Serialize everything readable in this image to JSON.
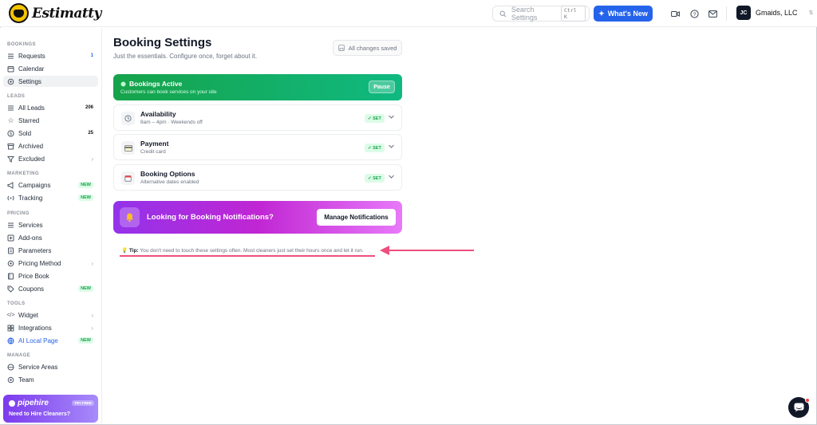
{
  "app": {
    "brand": "Estimatty"
  },
  "topbar": {
    "search_placeholder": "Search Settings",
    "search_shortcut": "Ctrl K",
    "whats_new": "What's New",
    "account": {
      "initials": "JC",
      "name": "Gmaids, LLC"
    }
  },
  "sidebar": {
    "sections": {
      "bookings": "BOOKINGS",
      "leads": "LEADS",
      "marketing": "MARKETING",
      "pricing": "PRICING",
      "tools": "TOOLS",
      "manage": "MANAGE"
    },
    "items": {
      "requests": {
        "label": "Requests",
        "badge": "1"
      },
      "calendar": {
        "label": "Calendar"
      },
      "settings": {
        "label": "Settings"
      },
      "all_leads": {
        "label": "All Leads",
        "badge": "206"
      },
      "starred": {
        "label": "Starred"
      },
      "sold": {
        "label": "Sold",
        "badge": "25"
      },
      "archived": {
        "label": "Archived"
      },
      "excluded": {
        "label": "Excluded"
      },
      "campaigns": {
        "label": "Campaigns",
        "tag": "NEW"
      },
      "tracking": {
        "label": "Tracking",
        "tag": "NEW"
      },
      "services": {
        "label": "Services"
      },
      "add_ons": {
        "label": "Add-ons"
      },
      "parameters": {
        "label": "Parameters"
      },
      "pricing_method": {
        "label": "Pricing Method"
      },
      "price_book": {
        "label": "Price Book"
      },
      "coupons": {
        "label": "Coupons",
        "tag": "NEW"
      },
      "widget": {
        "label": "Widget"
      },
      "integrations": {
        "label": "Integrations"
      },
      "ai_local_page": {
        "label": "AI Local Page",
        "tag": "NEW"
      },
      "service_areas": {
        "label": "Service Areas"
      },
      "team": {
        "label": "Team"
      }
    },
    "promo": {
      "brand": "pipehire",
      "tag": "TRY FREE",
      "text": "Need to Hire Cleaners?"
    }
  },
  "main": {
    "title": "Booking Settings",
    "subtitle": "Just the essentials. Configure once, forget about it.",
    "saved_status": "All changes saved",
    "active_card": {
      "title": "Bookings Active",
      "subtitle": "Customers can book services on your site",
      "button": "Pause"
    },
    "settings": [
      {
        "title": "Availability",
        "subtitle": "8am – 4pm · Weekends off",
        "status": "SET"
      },
      {
        "title": "Payment",
        "subtitle": "Credit card",
        "status": "SET"
      },
      {
        "title": "Booking Options",
        "subtitle": "Alternative dates enabled",
        "status": "SET"
      }
    ],
    "notifications": {
      "text": "Looking for Booking Notifications?",
      "button": "Manage Notifications"
    },
    "tip": {
      "label": "Tip:",
      "text": "You don't need to touch these settings often. Most cleaners just set their hours once and let it run."
    }
  },
  "colors": {
    "accent": "#2563eb",
    "active_green": "#16a34a",
    "notif_purple": "#9333ea",
    "annotation": "#ef4f7e"
  }
}
